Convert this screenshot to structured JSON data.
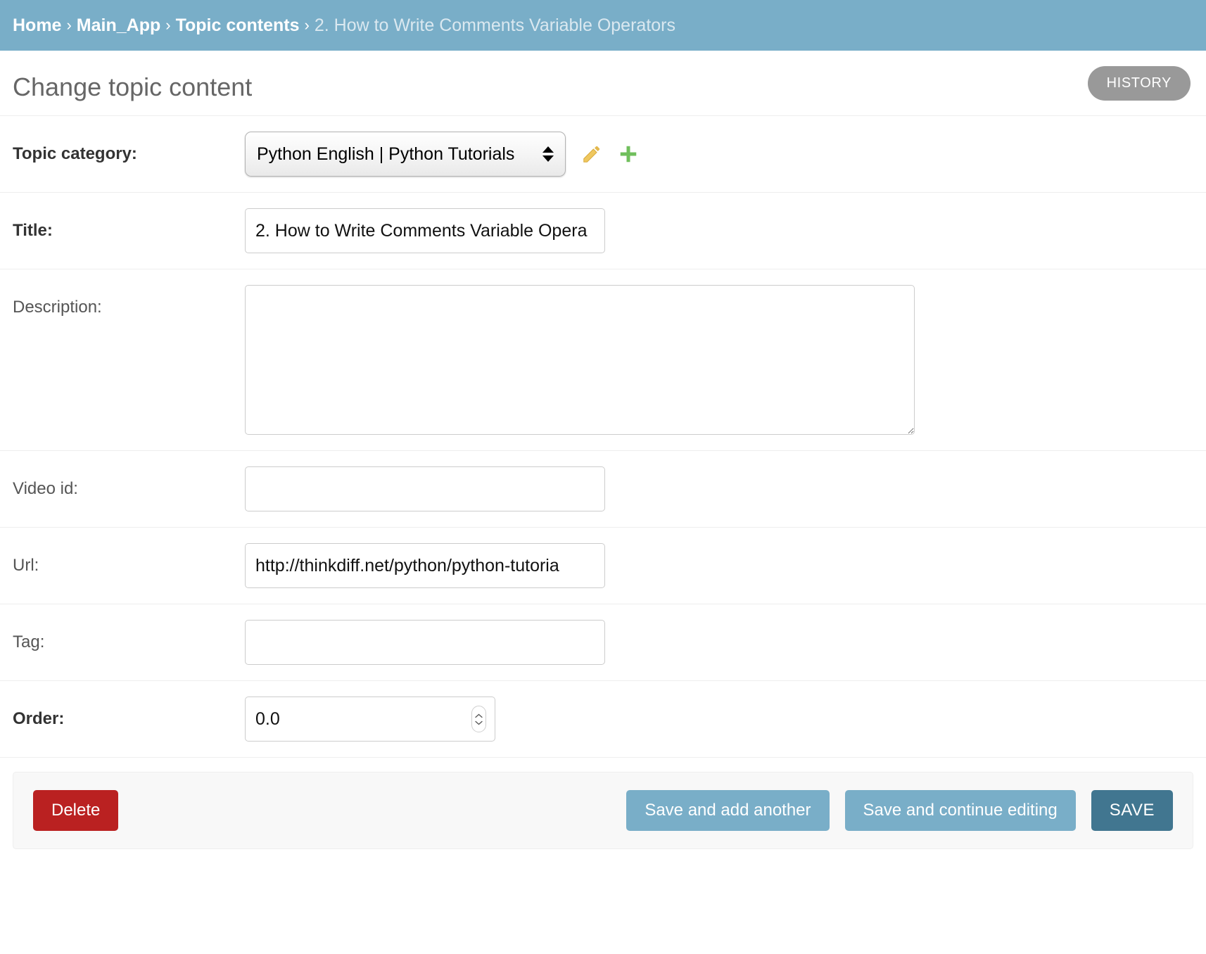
{
  "breadcrumbs": {
    "items": [
      {
        "label": "Home",
        "current": false
      },
      {
        "label": "Main_App",
        "current": false
      },
      {
        "label": "Topic contents",
        "current": false
      },
      {
        "label": "2. How to Write Comments Variable Operators",
        "current": true
      }
    ],
    "separator": "›",
    "background_color": "#79aec8"
  },
  "header": {
    "title": "Change topic content",
    "history_label": "HISTORY"
  },
  "form": {
    "rows": [
      {
        "name": "topic-category",
        "label": "Topic category:",
        "required": true,
        "widget": "select",
        "value": "Python English | Python Tutorials",
        "options": [
          "Python English | Python Tutorials"
        ],
        "icons": [
          "pencil-icon",
          "plus-icon"
        ]
      },
      {
        "name": "title",
        "label": "Title:",
        "required": true,
        "widget": "text",
        "value": "2. How to Write Comments Variable Opera",
        "placeholder": ""
      },
      {
        "name": "description",
        "label": "Description:",
        "required": false,
        "widget": "textarea",
        "value": "",
        "placeholder": ""
      },
      {
        "name": "video-id",
        "label": "Video id:",
        "required": false,
        "widget": "text",
        "value": "",
        "placeholder": ""
      },
      {
        "name": "url",
        "label": "Url:",
        "required": false,
        "widget": "text",
        "value": "http://thinkdiff.net/python/python-tutoria",
        "placeholder": ""
      },
      {
        "name": "tag",
        "label": "Tag:",
        "required": false,
        "widget": "text",
        "value": "",
        "placeholder": ""
      },
      {
        "name": "order",
        "label": "Order:",
        "required": true,
        "widget": "number",
        "value": "0.0",
        "placeholder": ""
      }
    ]
  },
  "submit_row": {
    "delete_label": "Delete",
    "save_and_add_another_label": "Save and add another",
    "save_and_continue_label": "Save and continue editing",
    "save_label": "SAVE"
  },
  "colors": {
    "brand": "#79aec8",
    "save_primary": "#417690",
    "delete": "#ba2121",
    "history": "#999999",
    "pencil_icon": "#efc75e",
    "plus_icon": "#70bf5c"
  }
}
